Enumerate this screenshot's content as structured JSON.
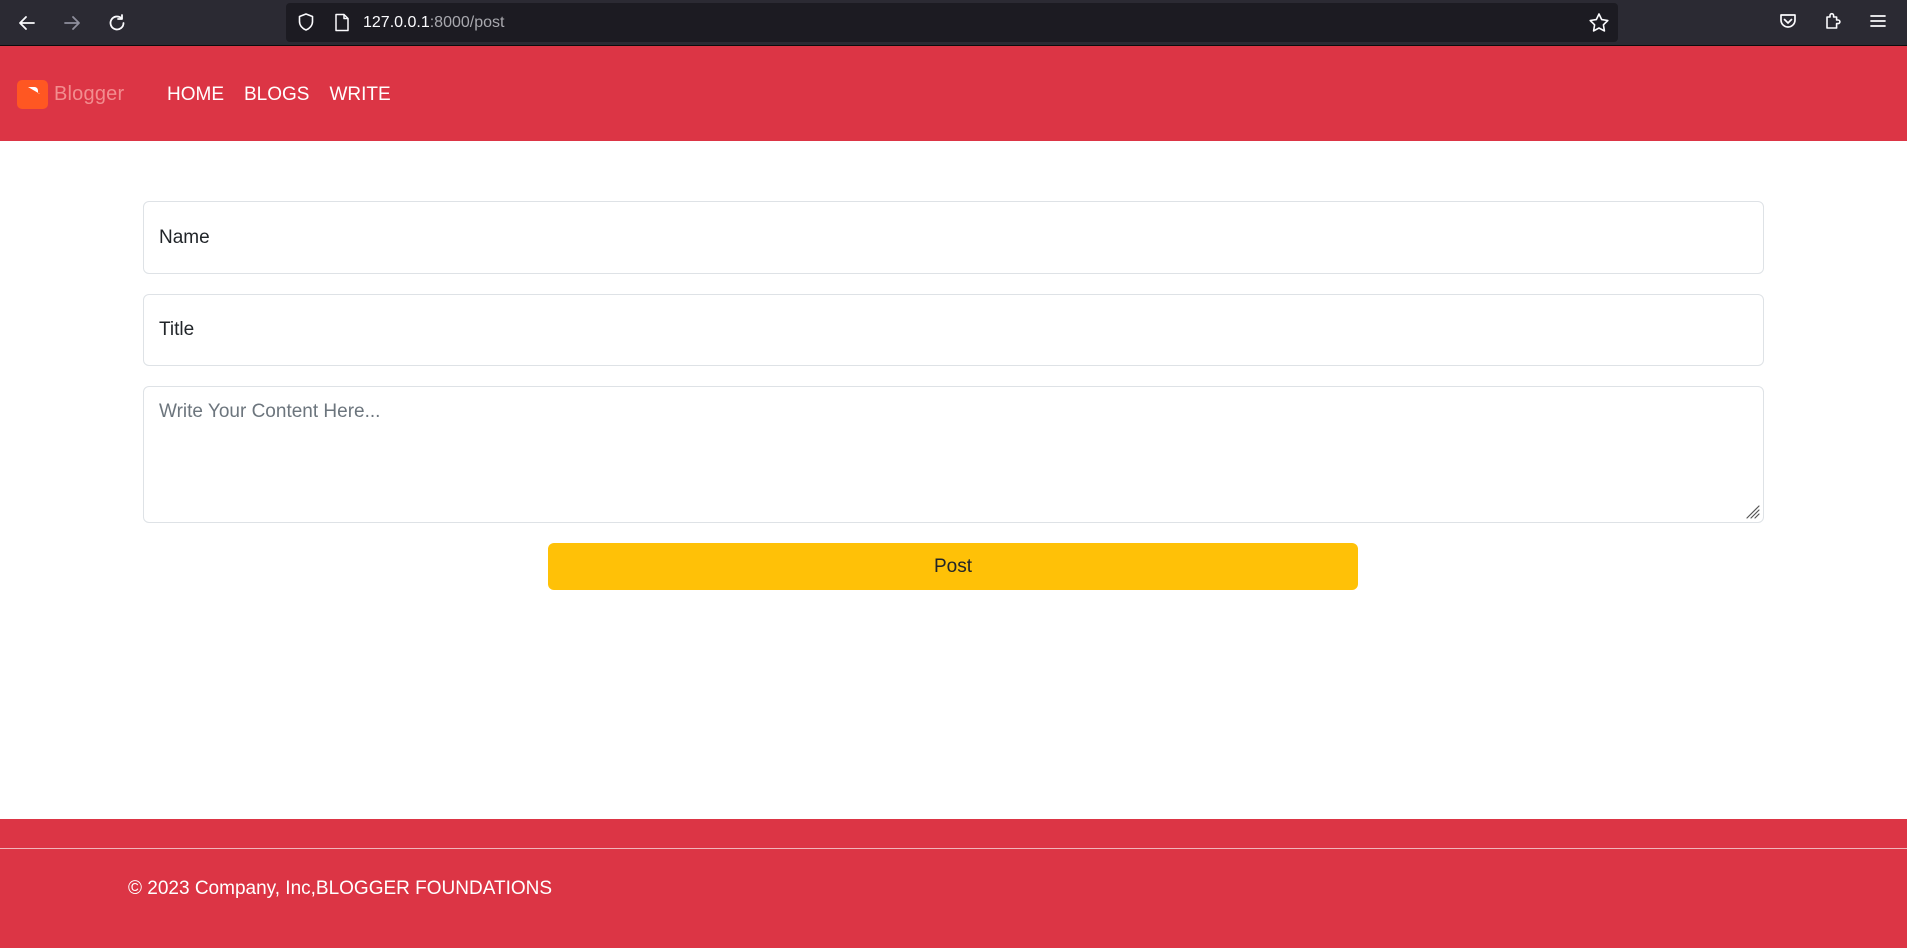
{
  "browser": {
    "url_host": "127.0.0.1",
    "url_path": ":8000/post"
  },
  "header": {
    "logo_text": "Blogger",
    "nav": [
      {
        "label": "HOME"
      },
      {
        "label": "BLOGS"
      },
      {
        "label": "WRITE"
      }
    ]
  },
  "form": {
    "name_placeholder": "Name",
    "title_placeholder": "Title",
    "content_placeholder": "Write Your Content Here...",
    "submit_label": "Post"
  },
  "footer": {
    "copyright": "© 2023 Company, Inc,BLOGGER FOUNDATIONS"
  },
  "colors": {
    "header_bg": "#dc3545",
    "button_bg": "#ffc107",
    "logo_orange": "#ff5722",
    "browser_bg": "#2b2a33"
  },
  "icons": {
    "back": "arrow-left-icon",
    "forward": "arrow-right-icon",
    "reload": "reload-icon",
    "shield": "shield-icon",
    "page": "page-icon",
    "bookmark": "star-icon",
    "pocket": "pocket-icon",
    "extensions": "puzzle-icon",
    "menu": "hamburger-menu-icon",
    "logo": "blogger-logo-icon"
  }
}
